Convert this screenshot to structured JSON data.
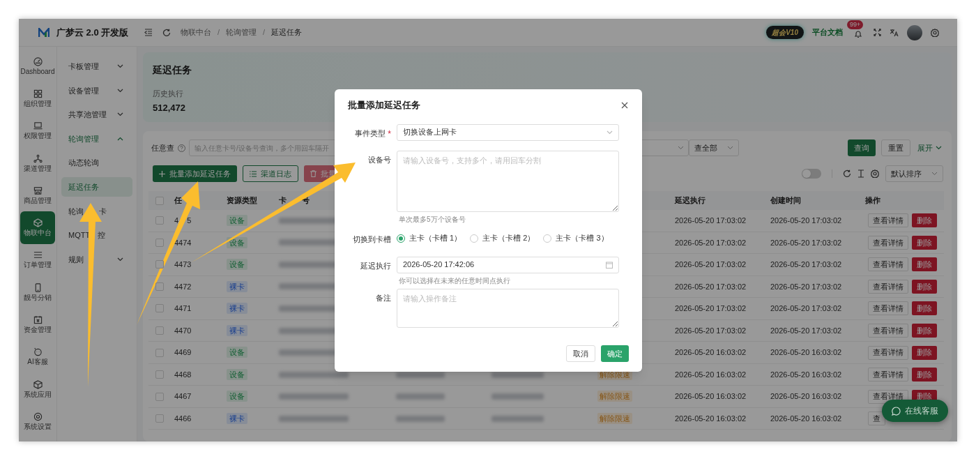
{
  "app": {
    "name": "广梦云 2.0 开发版"
  },
  "breadcrumb": [
    {
      "text": "物联中台"
    },
    {
      "separator": "/",
      "text": "轮询管理"
    },
    {
      "separator": "/",
      "text": "延迟任务"
    }
  ],
  "header": {
    "vip_badge": "超会V10",
    "docs_link": "平台文档",
    "notification_count": "99+"
  },
  "rail": [
    {
      "label": "Dashboard",
      "selected": false
    },
    {
      "label": "组织管理",
      "selected": false
    },
    {
      "label": "权限管理",
      "selected": false
    },
    {
      "label": "渠道管理",
      "selected": false
    },
    {
      "label": "商品管理",
      "selected": false
    },
    {
      "label": "物联中台",
      "selected": true
    },
    {
      "label": "订单管理",
      "selected": false
    },
    {
      "label": "靓号分销",
      "selected": false
    },
    {
      "label": "资金管理",
      "selected": false
    },
    {
      "label": "AI客服",
      "selected": false
    },
    {
      "label": "系统应用",
      "selected": false
    },
    {
      "label": "系统设置",
      "selected": false
    }
  ],
  "sidebar": [
    {
      "parts": [
        "卡板管理"
      ],
      "expanded": false,
      "selected": false
    },
    {
      "parts": [
        "设备管理"
      ],
      "expanded": false,
      "selected": false
    },
    {
      "parts": [
        "共享池管理"
      ],
      "expanded": false,
      "selected": false
    },
    {
      "parts": [
        "轮询管理"
      ],
      "expanded": true,
      "selected": true,
      "children": [
        {
          "parts": [
            "动态轮询"
          ],
          "selected": false
        },
        {
          "parts": [
            "延迟任务"
          ],
          "selected": true
        },
        {
          "parts": [
            "轮询",
            "卡"
          ],
          "selected": false
        },
        {
          "parts": [
            "MQTT",
            "控"
          ],
          "selected": false
        }
      ]
    },
    {
      "parts": [
        "规则"
      ],
      "expanded": false,
      "selected": false
    }
  ],
  "page": {
    "title": "延迟任务",
    "stat_label": "历史执行",
    "stat_value": "512,472"
  },
  "filters": {
    "label": "任意查",
    "placeholder": "输入任意卡号/设备号查询，多个用回车隔开",
    "scope": "查全部",
    "query_button": "查询",
    "reset_button": "重置",
    "expand_link": "展开"
  },
  "actions": {
    "add": "批量添加延迟任务",
    "log": "渠道日志",
    "delete": "批量"
  },
  "toolbar": {
    "toggle_on": false,
    "sort": "默认排序"
  },
  "table": {
    "select_all_checked": false,
    "columns": [
      [
        "任"
      ],
      [
        "资源类型"
      ],
      [
        "卡",
        "号"
      ],
      [
        "延迟执行"
      ],
      [
        "创建时间"
      ],
      [
        "操作"
      ]
    ],
    "rows": [
      {
        "checked": false,
        "id": [
          "4",
          "5"
        ],
        "type": {
          "text": "设备",
          "kind": "device"
        },
        "delay": "2026-05-20 17:03:02",
        "created": "2026-05-20 17:03:02",
        "view_button": "查看详情",
        "delete_button": "删除"
      },
      {
        "checked": false,
        "id": [
          "4474"
        ],
        "type": {
          "text": "设备",
          "kind": "device"
        },
        "delay": "2026-05-20 17:03:02",
        "created": "2026-05-20 17:03:02",
        "view_button": "查看详情",
        "delete_button": "删除"
      },
      {
        "checked": false,
        "id": [
          "4473"
        ],
        "type": {
          "text": "设备",
          "kind": "device"
        },
        "delay": "2026-05-20 17:03:02",
        "created": "2026-05-20 17:03:02",
        "view_button": "查看详情",
        "delete_button": "删除"
      },
      {
        "checked": false,
        "id": [
          "4472"
        ],
        "type": {
          "text": "裸卡",
          "kind": "bare_card"
        },
        "delay": "2026-05-20 17:03:02",
        "created": "2026-05-20 17:03:02",
        "view_button": "查看详情",
        "delete_button": "删除"
      },
      {
        "checked": false,
        "id": [
          "4471"
        ],
        "type": {
          "text": "裸卡",
          "kind": "bare_card"
        },
        "delay": "2026-05-20 17:03:02",
        "created": "2026-05-20 17:03:02",
        "view_button": "查看详情",
        "delete_button": "删除"
      },
      {
        "checked": false,
        "id": [
          "4470"
        ],
        "type": {
          "text": "裸卡",
          "kind": "bare_card"
        },
        "delay": "2026-05-20 17:03:02",
        "created": "2026-05-20 17:03:02",
        "view_button": "查看详情",
        "delete_button": "删除"
      },
      {
        "checked": false,
        "id": [
          "4469"
        ],
        "type": {
          "text": "设备",
          "kind": "device"
        },
        "delay": "2026-05-20 16:03:02",
        "created": "2026-05-20 16:03:02",
        "view_button": "查看详情",
        "delete_button": "删除"
      },
      {
        "checked": false,
        "id": [
          "4468"
        ],
        "type": {
          "text": "设备",
          "kind": "device"
        },
        "status": "解除限速",
        "delay": "2026-05-20 16:03:02",
        "created": "2026-05-20 16:03:02",
        "view_button": "查看详情",
        "delete_button": "删除"
      },
      {
        "checked": false,
        "id": [
          "4467"
        ],
        "type": {
          "text": "设备",
          "kind": "device"
        },
        "status": "解除限速",
        "delay": "2026-05-20 16:03:02",
        "created": "2026-05-20 16:03:02",
        "view_button": "查看详情",
        "delete_button": "删除"
      },
      {
        "checked": false,
        "id": [
          "4466"
        ],
        "type": {
          "text": "裸卡",
          "kind": "bare_card"
        },
        "status": "解除限速",
        "delay": "2026-05-20 16:03:02",
        "created": "2026-05-20 16:03:02",
        "view_button": "查"
      }
    ]
  },
  "chat_button": "在线客服",
  "dialog": {
    "title": "批量添加延迟任务",
    "event_label": "事件类型",
    "event_required_mark": "*",
    "event_value": "切换设备上网卡",
    "device_label": "设备号",
    "device_placeholder": "请输入设备号，支持多个，请用回车分割",
    "device_hint": "单次最多5万个设备号",
    "slot_label": "切换到卡槽",
    "slots": [
      {
        "label": "主卡（卡槽 1）",
        "selected": true
      },
      {
        "label": "主卡（卡槽 2）",
        "selected": false
      },
      {
        "label": "主卡（卡槽 3）",
        "selected": false
      }
    ],
    "delay_label": "延迟执行",
    "delay_value": "2026-05-20 17:42:06",
    "delay_hint": "你可以选择在未来的任意时间点执行",
    "note_label": "备注",
    "note_placeholder": "请输入操作备注",
    "cancel": "取消",
    "confirm": "确定"
  }
}
